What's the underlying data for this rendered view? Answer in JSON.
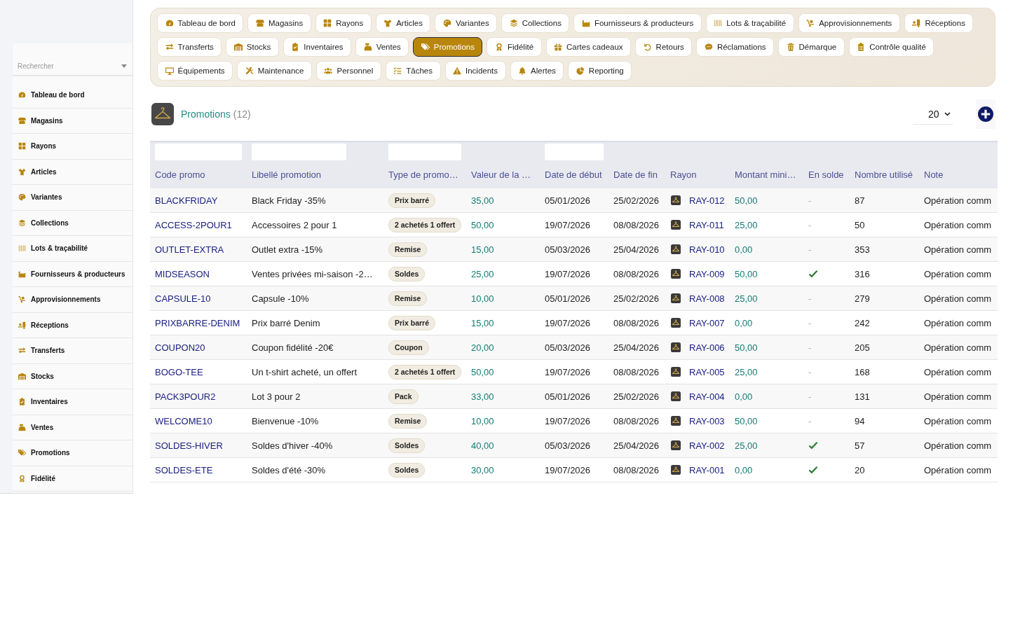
{
  "sidebar": {
    "search": {
      "placeholder": "Rechercher"
    },
    "items": [
      "Tableau de bord",
      "Magasins",
      "Rayons",
      "Articles",
      "Variantes",
      "Collections",
      "Lots & traçabilité",
      "Fournisseurs & producteurs",
      "Approvisionnements",
      "Réceptions",
      "Transferts",
      "Stocks",
      "Inventaires",
      "Ventes",
      "Promotions",
      "Fidélité"
    ]
  },
  "nav": {
    "items": [
      {
        "label": "Tableau de bord",
        "selected": false
      },
      {
        "label": "Magasins",
        "selected": false
      },
      {
        "label": "Rayons",
        "selected": false
      },
      {
        "label": "Articles",
        "selected": false
      },
      {
        "label": "Variantes",
        "selected": false
      },
      {
        "label": "Collections",
        "selected": false
      },
      {
        "label": "Fournisseurs & producteurs",
        "selected": false
      },
      {
        "label": "Lots & traçabilité",
        "selected": false
      },
      {
        "label": "Approvisionnements",
        "selected": false
      },
      {
        "label": "Réceptions",
        "selected": false
      },
      {
        "label": "Transferts",
        "selected": false
      },
      {
        "label": "Stocks",
        "selected": false
      },
      {
        "label": "Inventaires",
        "selected": false
      },
      {
        "label": "Ventes",
        "selected": false
      },
      {
        "label": "Promotions",
        "selected": true
      },
      {
        "label": "Fidélité",
        "selected": false
      },
      {
        "label": "Cartes cadeaux",
        "selected": false
      },
      {
        "label": "Retours",
        "selected": false
      },
      {
        "label": "Réclamations",
        "selected": false
      },
      {
        "label": "Démarque",
        "selected": false
      },
      {
        "label": "Contrôle qualité",
        "selected": false
      },
      {
        "label": "Équipements",
        "selected": false
      },
      {
        "label": "Maintenance",
        "selected": false
      },
      {
        "label": "Personnel",
        "selected": false
      },
      {
        "label": "Tâches",
        "selected": false
      },
      {
        "label": "Incidents",
        "selected": false
      },
      {
        "label": "Alertes",
        "selected": false
      },
      {
        "label": "Reporting",
        "selected": false
      }
    ]
  },
  "page": {
    "title": "Promotions",
    "count": "(12)",
    "page_size": "20"
  },
  "table": {
    "columns": [
      {
        "label": "Code promo",
        "filterable": true
      },
      {
        "label": "Libellé promotion",
        "filterable": true
      },
      {
        "label": "Type de promo…",
        "filterable": true
      },
      {
        "label": "Valeur de la …",
        "filterable": false
      },
      {
        "label": "Date de début",
        "filterable": true
      },
      {
        "label": "Date de fin",
        "filterable": false
      },
      {
        "label": "Rayon",
        "filterable": false
      },
      {
        "label": "Montant mini…",
        "filterable": false
      },
      {
        "label": "En solde",
        "filterable": false
      },
      {
        "label": "Nombre utilisé",
        "filterable": false
      },
      {
        "label": "Note",
        "filterable": false
      }
    ],
    "rows": [
      {
        "code": "BLACKFRIDAY",
        "label": "Black Friday -35%",
        "type": "Prix barré",
        "value": "35,00",
        "start": "05/01/2026",
        "end": "25/02/2026",
        "rayon": "RAY-012",
        "min_amount": "50,00",
        "on_sale": false,
        "on_sale_placeholder": "-",
        "uses": "87",
        "note": "Opération comm"
      },
      {
        "code": "ACCESS-2POUR1",
        "label": "Accessoires 2 pour 1",
        "type": "2 achetés 1 offert",
        "value": "50,00",
        "start": "19/07/2026",
        "end": "08/08/2026",
        "rayon": "RAY-011",
        "min_amount": "25,00",
        "on_sale": false,
        "on_sale_placeholder": "-",
        "uses": "50",
        "note": "Opération comm"
      },
      {
        "code": "OUTLET-EXTRA",
        "label": "Outlet extra -15%",
        "type": "Remise",
        "value": "15,00",
        "start": "05/03/2026",
        "end": "25/04/2026",
        "rayon": "RAY-010",
        "min_amount": "0,00",
        "on_sale": false,
        "on_sale_placeholder": "-",
        "uses": "353",
        "note": "Opération comm"
      },
      {
        "code": "MIDSEASON",
        "label": "Ventes privées mi-saison -2…",
        "type": "Soldes",
        "value": "25,00",
        "start": "19/07/2026",
        "end": "08/08/2026",
        "rayon": "RAY-009",
        "min_amount": "50,00",
        "on_sale": true,
        "uses": "316",
        "note": "Opération comm"
      },
      {
        "code": "CAPSULE-10",
        "label": "Capsule -10%",
        "type": "Remise",
        "value": "10,00",
        "start": "05/01/2026",
        "end": "25/02/2026",
        "rayon": "RAY-008",
        "min_amount": "25,00",
        "on_sale": false,
        "on_sale_placeholder": "-",
        "uses": "279",
        "note": "Opération comm"
      },
      {
        "code": "PRIXBARRE-DENIM",
        "label": "Prix barré Denim",
        "type": "Prix barré",
        "value": "15,00",
        "start": "19/07/2026",
        "end": "08/08/2026",
        "rayon": "RAY-007",
        "min_amount": "0,00",
        "on_sale": false,
        "on_sale_placeholder": "-",
        "uses": "242",
        "note": "Opération comm"
      },
      {
        "code": "COUPON20",
        "label": "Coupon fidélité -20€",
        "type": "Coupon",
        "value": "20,00",
        "start": "05/03/2026",
        "end": "25/04/2026",
        "rayon": "RAY-006",
        "min_amount": "50,00",
        "on_sale": false,
        "on_sale_placeholder": "-",
        "uses": "205",
        "note": "Opération comm"
      },
      {
        "code": "BOGO-TEE",
        "label": "Un t-shirt acheté, un offert",
        "type": "2 achetés 1 offert",
        "value": "50,00",
        "start": "19/07/2026",
        "end": "08/08/2026",
        "rayon": "RAY-005",
        "min_amount": "25,00",
        "on_sale": false,
        "on_sale_placeholder": "-",
        "uses": "168",
        "note": "Opération comm"
      },
      {
        "code": "PACK3POUR2",
        "label": "Lot 3 pour 2",
        "type": "Pack",
        "value": "33,00",
        "start": "05/01/2026",
        "end": "25/02/2026",
        "rayon": "RAY-004",
        "min_amount": "0,00",
        "on_sale": false,
        "on_sale_placeholder": "-",
        "uses": "131",
        "note": "Opération comm"
      },
      {
        "code": "WELCOME10",
        "label": "Bienvenue -10%",
        "type": "Remise",
        "value": "10,00",
        "start": "19/07/2026",
        "end": "08/08/2026",
        "rayon": "RAY-003",
        "min_amount": "50,00",
        "on_sale": false,
        "on_sale_placeholder": "-",
        "uses": "94",
        "note": "Opération comm"
      },
      {
        "code": "SOLDES-HIVER",
        "label": "Soldes d'hiver -40%",
        "type": "Soldes",
        "value": "40,00",
        "start": "05/03/2026",
        "end": "25/04/2026",
        "rayon": "RAY-002",
        "min_amount": "25,00",
        "on_sale": true,
        "uses": "57",
        "note": "Opération comm"
      },
      {
        "code": "SOLDES-ETE",
        "label": "Soldes d'été -30%",
        "type": "Soldes",
        "value": "30,00",
        "start": "19/07/2026",
        "end": "08/08/2026",
        "rayon": "RAY-001",
        "min_amount": "0,00",
        "on_sale": true,
        "uses": "20",
        "note": "Opération comm"
      }
    ]
  }
}
